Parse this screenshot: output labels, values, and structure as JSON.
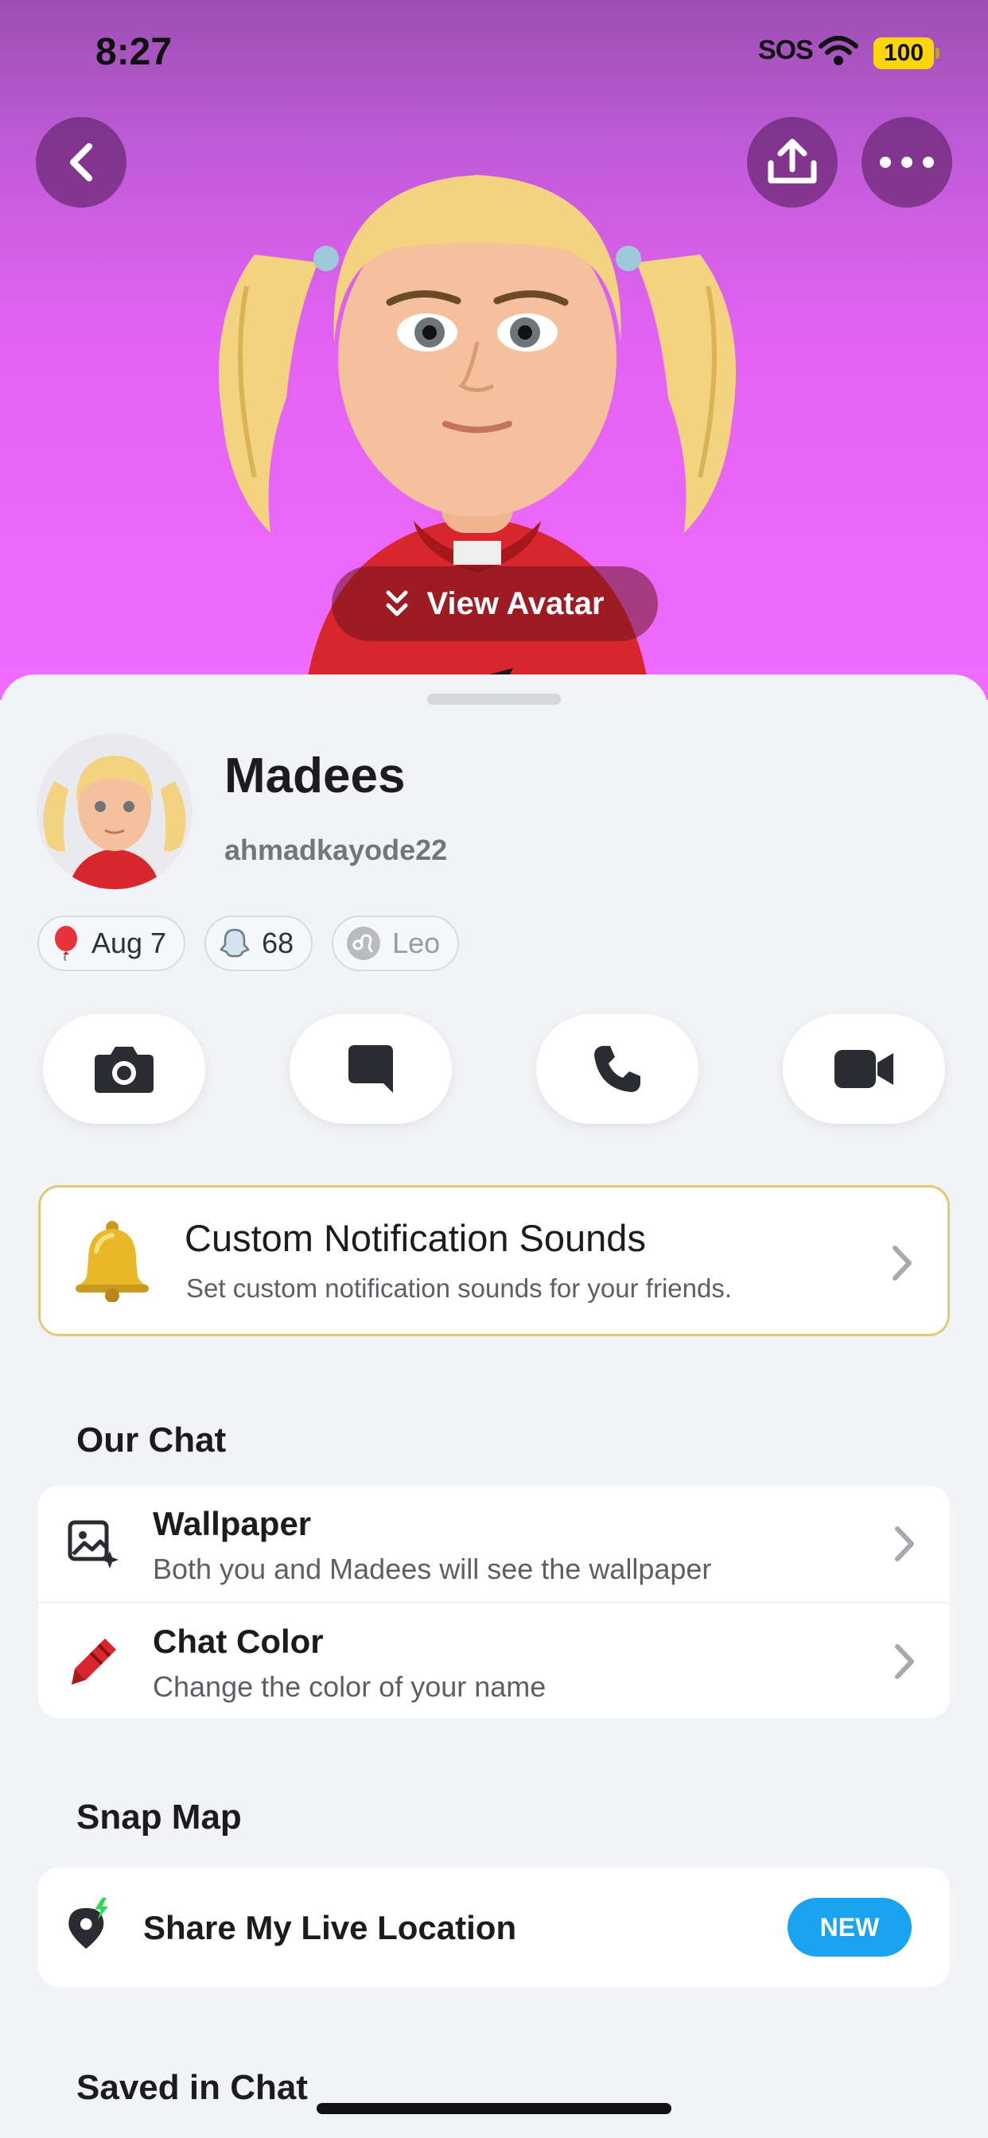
{
  "status_bar": {
    "time": "8:27",
    "sos": "SOS",
    "battery": "100"
  },
  "header": {
    "back_icon": "chevron-left-icon",
    "share_icon": "share-upload-icon",
    "more_icon": "more-dots-icon",
    "view_avatar_label": "View Avatar"
  },
  "profile": {
    "display_name": "Madees",
    "username": "ahmadkayode22",
    "chips": [
      {
        "icon": "balloon-icon",
        "label": "Aug 7"
      },
      {
        "icon": "ghost-icon",
        "label": "68"
      },
      {
        "icon": "leo-zodiac-icon",
        "label": "Leo"
      }
    ]
  },
  "actions": [
    {
      "icon": "camera-icon"
    },
    {
      "icon": "chat-bubble-icon"
    },
    {
      "icon": "phone-icon"
    },
    {
      "icon": "video-camera-icon"
    }
  ],
  "notification_card": {
    "icon": "bell-icon",
    "title": "Custom Notification Sounds",
    "subtitle": "Set custom notification sounds for your friends."
  },
  "our_chat": {
    "title": "Our Chat",
    "items": [
      {
        "icon": "wallpaper-icon",
        "title": "Wallpaper",
        "subtitle": "Both you and Madees will see the wallpaper"
      },
      {
        "icon": "crayon-icon",
        "title": "Chat Color",
        "subtitle": "Change the color of your name"
      }
    ]
  },
  "snap_map": {
    "title": "Snap Map",
    "items": [
      {
        "icon": "live-location-icon",
        "title": "Share My Live Location",
        "badge": "NEW"
      }
    ]
  },
  "saved_in_chat": {
    "title": "Saved in Chat"
  },
  "colors": {
    "hero_gradient_top": "#9c4fb2",
    "hero_gradient_bottom": "#f06bff",
    "new_badge": "#1aa3f0",
    "notification_border": "#e2c877"
  }
}
